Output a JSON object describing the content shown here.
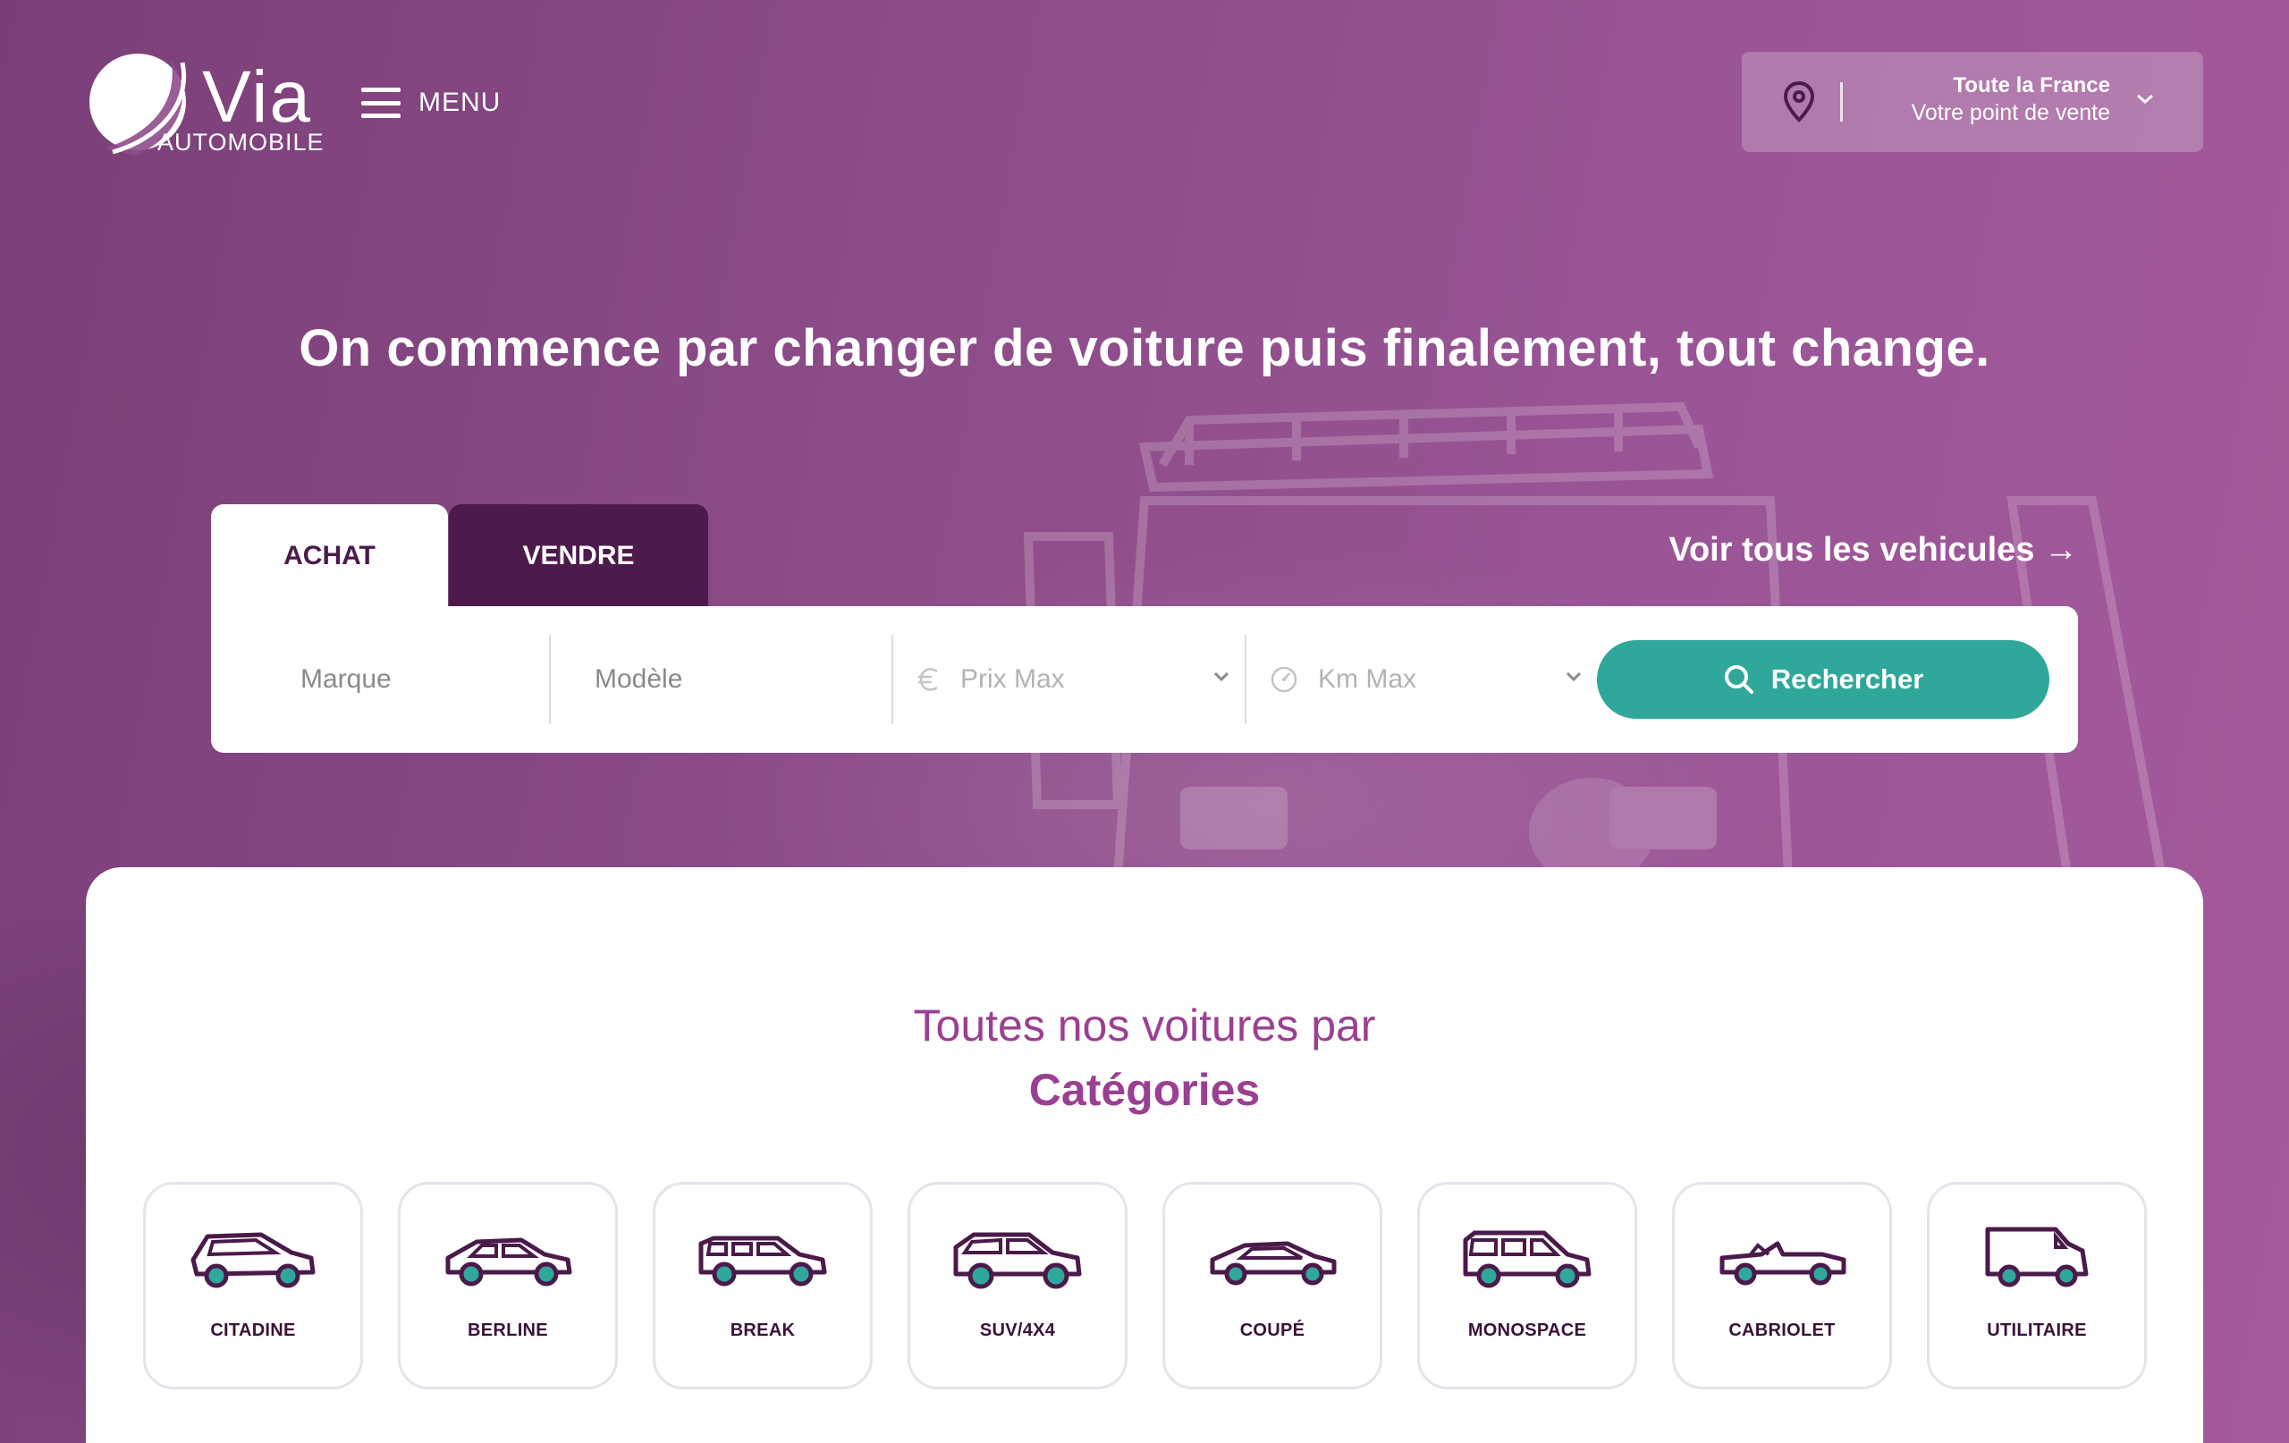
{
  "brand": {
    "name": "Via",
    "sub": "AUTOMOBILE"
  },
  "header": {
    "menu_label": "MENU",
    "location": {
      "title": "Toute la France",
      "subtitle": "Votre point de vente"
    }
  },
  "hero": {
    "headline": "On commence par changer de voiture puis finalement, tout change."
  },
  "search": {
    "tabs": [
      "ACHAT",
      "VENDRE"
    ],
    "all_vehicles_link": "Voir tous les vehicules →",
    "fields": {
      "marque": "Marque",
      "modele": "Modèle",
      "prix": "Prix Max",
      "km": "Km Max"
    },
    "button": "Rechercher"
  },
  "categories": {
    "subtitle": "Toutes nos voitures par",
    "title": "Catégories",
    "items": [
      "CITADINE",
      "BERLINE",
      "BREAK",
      "SUV/4X4",
      "COUPÉ",
      "MONOSPACE",
      "CABRIOLET",
      "UTILITAIRE"
    ]
  },
  "colors": {
    "accent": "#2fa89b",
    "brand_purple": "#9b3f92",
    "dark_purple": "#4d1a4c"
  },
  "icons": [
    "hamburger-icon",
    "location-pin-icon",
    "chevron-down-icon",
    "euro-icon",
    "speedometer-icon",
    "search-icon",
    "car-icon"
  ]
}
